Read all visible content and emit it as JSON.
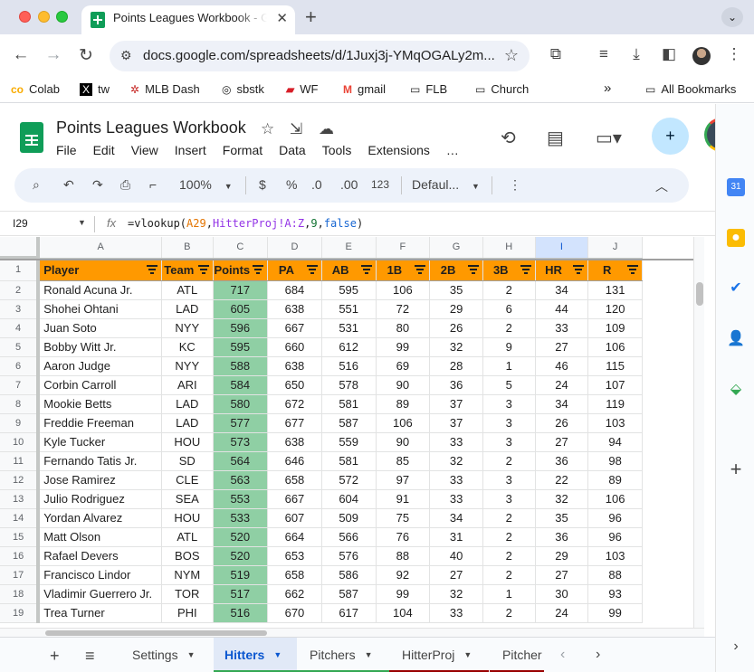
{
  "browser": {
    "tab_title": "Points Leagues Workbook - Google Sheets",
    "tab_close": "✕",
    "new_tab": "+",
    "url": "docs.google.com/spreadsheets/d/1Juxj3j-YMqOGALy2m...",
    "bookmarks": [
      "Colab",
      "tw",
      "MLB Dash",
      "sbstk",
      "WF",
      "gmail",
      "FLB",
      "Church"
    ],
    "more_bookmarks": "»",
    "all_bookmarks": "All Bookmarks"
  },
  "sheets": {
    "doc_title": "Points Leagues Workbook",
    "menus": [
      "File",
      "Edit",
      "View",
      "Insert",
      "Format",
      "Data",
      "Tools",
      "Extensions",
      "…"
    ],
    "toolbar": {
      "zoom": "100%",
      "currency": "$",
      "percent": "%",
      "dec_decrease": ".0",
      "dec_increase": ".00",
      "number_format": "123",
      "font": "Defaul..."
    },
    "name_box": "I29",
    "formula": {
      "prefix": "=vlookup(",
      "arg1": "A29",
      "sep1": ",",
      "arg2": "HitterProj!A:Z",
      "sep2": ",",
      "arg3": "9",
      "sep3": ",",
      "arg4": "false",
      "suffix": ")"
    }
  },
  "grid": {
    "column_letters": [
      "A",
      "B",
      "C",
      "D",
      "E",
      "F",
      "G",
      "H",
      "I",
      "J"
    ],
    "headers": [
      "Player",
      "Team",
      "Points",
      "PA",
      "AB",
      "1B",
      "2B",
      "3B",
      "HR",
      "R"
    ],
    "rows": [
      {
        "n": "2",
        "cells": [
          "Ronald Acuna Jr.",
          "ATL",
          "717",
          "684",
          "595",
          "106",
          "35",
          "2",
          "34",
          "131"
        ]
      },
      {
        "n": "3",
        "cells": [
          "Shohei Ohtani",
          "LAD",
          "605",
          "638",
          "551",
          "72",
          "29",
          "6",
          "44",
          "120"
        ]
      },
      {
        "n": "4",
        "cells": [
          "Juan Soto",
          "NYY",
          "596",
          "667",
          "531",
          "80",
          "26",
          "2",
          "33",
          "109"
        ]
      },
      {
        "n": "5",
        "cells": [
          "Bobby Witt Jr.",
          "KC",
          "595",
          "660",
          "612",
          "99",
          "32",
          "9",
          "27",
          "106"
        ]
      },
      {
        "n": "6",
        "cells": [
          "Aaron Judge",
          "NYY",
          "588",
          "638",
          "516",
          "69",
          "28",
          "1",
          "46",
          "115"
        ]
      },
      {
        "n": "7",
        "cells": [
          "Corbin Carroll",
          "ARI",
          "584",
          "650",
          "578",
          "90",
          "36",
          "5",
          "24",
          "107"
        ]
      },
      {
        "n": "8",
        "cells": [
          "Mookie Betts",
          "LAD",
          "580",
          "672",
          "581",
          "89",
          "37",
          "3",
          "34",
          "119"
        ]
      },
      {
        "n": "9",
        "cells": [
          "Freddie Freeman",
          "LAD",
          "577",
          "677",
          "587",
          "106",
          "37",
          "3",
          "26",
          "103"
        ]
      },
      {
        "n": "10",
        "cells": [
          "Kyle Tucker",
          "HOU",
          "573",
          "638",
          "559",
          "90",
          "33",
          "3",
          "27",
          "94"
        ]
      },
      {
        "n": "11",
        "cells": [
          "Fernando Tatis Jr.",
          "SD",
          "564",
          "646",
          "581",
          "85",
          "32",
          "2",
          "36",
          "98"
        ]
      },
      {
        "n": "12",
        "cells": [
          "Jose Ramirez",
          "CLE",
          "563",
          "658",
          "572",
          "97",
          "33",
          "3",
          "22",
          "89"
        ]
      },
      {
        "n": "13",
        "cells": [
          "Julio Rodriguez",
          "SEA",
          "553",
          "667",
          "604",
          "91",
          "33",
          "3",
          "32",
          "106"
        ]
      },
      {
        "n": "14",
        "cells": [
          "Yordan Alvarez",
          "HOU",
          "533",
          "607",
          "509",
          "75",
          "34",
          "2",
          "35",
          "96"
        ]
      },
      {
        "n": "15",
        "cells": [
          "Matt Olson",
          "ATL",
          "520",
          "664",
          "566",
          "76",
          "31",
          "2",
          "36",
          "96"
        ]
      },
      {
        "n": "16",
        "cells": [
          "Rafael Devers",
          "BOS",
          "520",
          "653",
          "576",
          "88",
          "40",
          "2",
          "29",
          "103"
        ]
      },
      {
        "n": "17",
        "cells": [
          "Francisco Lindor",
          "NYM",
          "519",
          "658",
          "586",
          "92",
          "27",
          "2",
          "27",
          "88"
        ]
      },
      {
        "n": "18",
        "cells": [
          "Vladimir Guerrero Jr.",
          "TOR",
          "517",
          "662",
          "587",
          "99",
          "32",
          "1",
          "30",
          "93"
        ]
      },
      {
        "n": "19",
        "cells": [
          "Trea Turner",
          "PHI",
          "516",
          "670",
          "617",
          "104",
          "33",
          "2",
          "24",
          "99"
        ]
      }
    ]
  },
  "sheet_tabs": [
    {
      "label": "Settings",
      "color": "",
      "active": false
    },
    {
      "label": "Hitters",
      "color": "#34a853",
      "active": true
    },
    {
      "label": "Pitchers",
      "color": "#34a853",
      "active": false
    },
    {
      "label": "HitterProj",
      "color": "#990000",
      "active": false
    },
    {
      "label": "Pitcher",
      "color": "#990000",
      "active": false
    }
  ],
  "colors": {
    "header_fill": "#ff9900",
    "points_fill": "#8fcfa4",
    "selection": "#d3e3fd"
  }
}
